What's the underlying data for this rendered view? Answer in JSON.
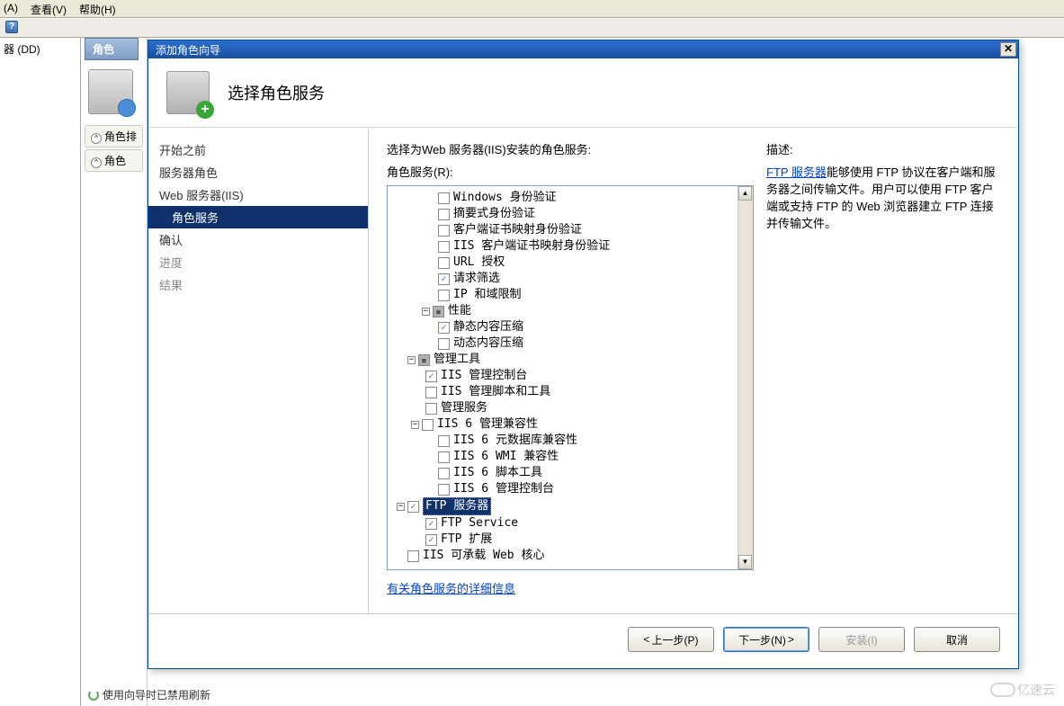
{
  "menubar": {
    "items": [
      "(A)",
      "查看(V)",
      "帮助(H)"
    ]
  },
  "leftTree": {
    "root": "器 (DD)"
  },
  "midPanel": {
    "title": "角色",
    "acc1": "角色排",
    "acc2": "角色"
  },
  "refreshMsg": "使用向导时已禁用刷新",
  "watermark": "亿速云",
  "dialog": {
    "title": "添加角色向导",
    "heading": "选择角色服务",
    "nav": {
      "before": "开始之前",
      "serverRoles": "服务器角色",
      "webServer": "Web 服务器(IIS)",
      "roleServices": "角色服务",
      "confirm": "确认",
      "progress": "进度",
      "result": "结果"
    },
    "instruction": "选择为Web 服务器(IIS)安装的角色服务:",
    "treeLabel": "角色服务(R):",
    "descLabel": "描述:",
    "descLink": "FTP 服务器",
    "descText": "能够使用 FTP 协议在客户端和服务器之间传输文件。用户可以使用 FTP 客户端或支持 FTP 的 Web 浏览器建立 FTP 连接并传输文件。",
    "moreLink": "有关角色服务的详细信息",
    "tree": {
      "winAuth": "Windows 身份验证",
      "digestAuth": "摘要式身份验证",
      "clientCert": "客户端证书映射身份验证",
      "iisClientCert": "IIS 客户端证书映射身份验证",
      "urlAuth": "URL 授权",
      "reqFilter": "请求筛选",
      "ipRestrict": "IP 和域限制",
      "performance": "性能",
      "staticComp": "静态内容压缩",
      "dynComp": "动态内容压缩",
      "mgmtTools": "管理工具",
      "iisConsole": "IIS 管理控制台",
      "iisScripts": "IIS 管理脚本和工具",
      "mgmtService": "管理服务",
      "iis6Compat": "IIS 6 管理兼容性",
      "iis6Meta": "IIS 6 元数据库兼容性",
      "iis6Wmi": "IIS 6 WMI 兼容性",
      "iis6Script": "IIS 6 脚本工具",
      "iis6Console": "IIS 6 管理控制台",
      "ftpServer": "FTP 服务器",
      "ftpService": "FTP Service",
      "ftpExt": "FTP 扩展",
      "iisHostable": "IIS 可承载 Web 核心"
    },
    "buttons": {
      "prev": "上一步(P)",
      "next": "下一步(N)",
      "install": "安装(I)",
      "cancel": "取消"
    }
  }
}
